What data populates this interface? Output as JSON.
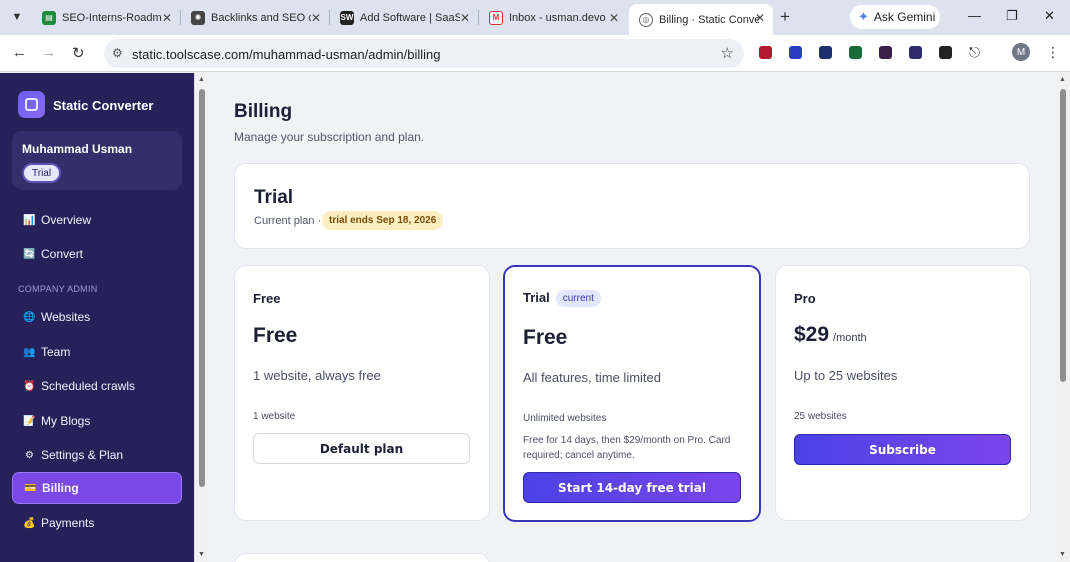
{
  "browser": {
    "tabs": [
      {
        "title": "SEO-Interns-Roadm",
        "icon": "sheets-icon",
        "color": "#1e8e3e",
        "glyph": "▤"
      },
      {
        "title": "Backlinks and SEO c",
        "icon": "openai-icon",
        "color": "#444444",
        "glyph": "✺"
      },
      {
        "title": "Add Software | SaaS",
        "icon": "sw-icon",
        "color": "#222222",
        "glyph": "SW"
      },
      {
        "title": "Inbox - usman.devo",
        "icon": "gmail-icon",
        "color": "#d93025",
        "glyph": "M"
      },
      {
        "title": "Billing · Static Conve",
        "icon": "globe-icon",
        "color": "#5f6368",
        "glyph": "◎"
      }
    ],
    "ask_gemini": "Ask Gemini",
    "url": "static.toolscase.com/muhammad-usman/admin/billing",
    "profile_initial": "M",
    "extension_colors": [
      "#b1172f",
      "#2a3bc6",
      "#1c2f6e",
      "#1b6b3a",
      "#3a1f4b",
      "#2d2a6e",
      "#222222"
    ]
  },
  "sidebar": {
    "app_name": "Static Converter",
    "user_name": "Muhammad Usman",
    "user_plan_badge": "Trial",
    "section_label": "COMPANY ADMIN",
    "items": [
      {
        "label": "Overview",
        "icon": "chart-icon",
        "glyph": "📊"
      },
      {
        "label": "Convert",
        "icon": "convert-icon",
        "glyph": "🔄"
      },
      {
        "label": "Websites",
        "icon": "globe-icon",
        "glyph": "🌐"
      },
      {
        "label": "Team",
        "icon": "team-icon",
        "glyph": "👥"
      },
      {
        "label": "Scheduled crawls",
        "icon": "alarm-clock-icon",
        "glyph": "⏰"
      },
      {
        "label": "My Blogs",
        "icon": "notepad-icon",
        "glyph": "📝"
      },
      {
        "label": "Settings & Plan",
        "icon": "gear-icon",
        "glyph": "⚙"
      },
      {
        "label": "Billing",
        "icon": "credit-card-icon",
        "glyph": "💳"
      },
      {
        "label": "Payments",
        "icon": "money-bag-icon",
        "glyph": "💰"
      }
    ]
  },
  "main": {
    "title": "Billing",
    "subtitle": "Manage your subscription and plan.",
    "current_plan": {
      "name": "Trial",
      "meta": "Current plan ·",
      "trial_ends": "trial ends Sep 18, 2026"
    },
    "plans": [
      {
        "name": "Free",
        "badge": "",
        "price": "Free",
        "period": "",
        "description": "1 website, always free",
        "limit": "1 website",
        "note": "",
        "button": "Default plan"
      },
      {
        "name": "Trial",
        "badge": "current",
        "price": "Free",
        "period": "",
        "description": "All features, time limited",
        "limit": "Unlimited websites",
        "note": "Free for 14 days, then $29/month on Pro. Card required; cancel anytime.",
        "button": "Start 14-day free trial"
      },
      {
        "name": "Pro",
        "badge": "",
        "price": "$29",
        "period": "/month",
        "description": "Up to 25 websites",
        "limit": "25 websites",
        "note": "",
        "button": "Subscribe"
      }
    ]
  },
  "colors": {
    "sidebar_bg": "#262259",
    "accent": "#7b48e8",
    "primary_button": "#4b42e6",
    "trial_pill": "#fbefc2"
  }
}
